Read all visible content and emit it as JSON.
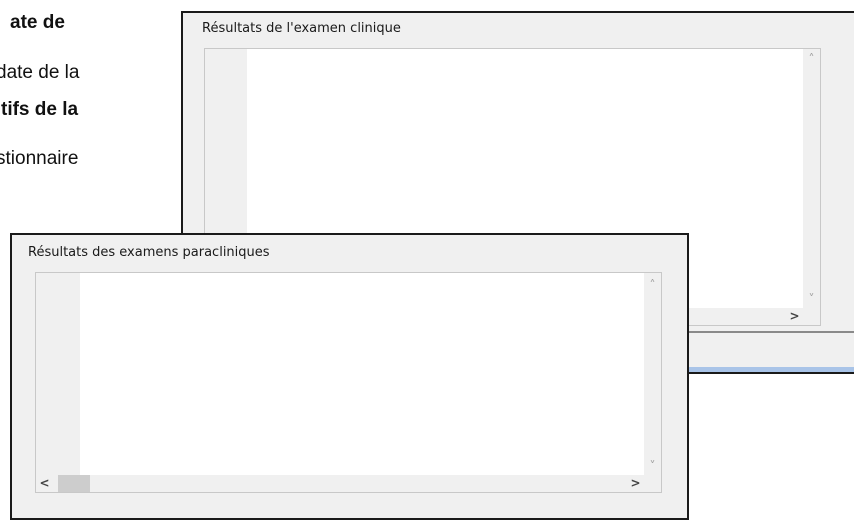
{
  "document": {
    "line1": "ate de",
    "line2": "date de la",
    "line3": "tifs de la",
    "line4": "stionnaire"
  },
  "window_clinical": {
    "title": "Résultats de l'examen clinique",
    "scroll_up": "˄",
    "scroll_down": "˅",
    "scroll_right": ">"
  },
  "window_paraclinical": {
    "title": "Résultats des examens paracliniques",
    "scroll_up": "˄",
    "scroll_down": "˅",
    "scroll_left": "<",
    "scroll_right": ">"
  }
}
